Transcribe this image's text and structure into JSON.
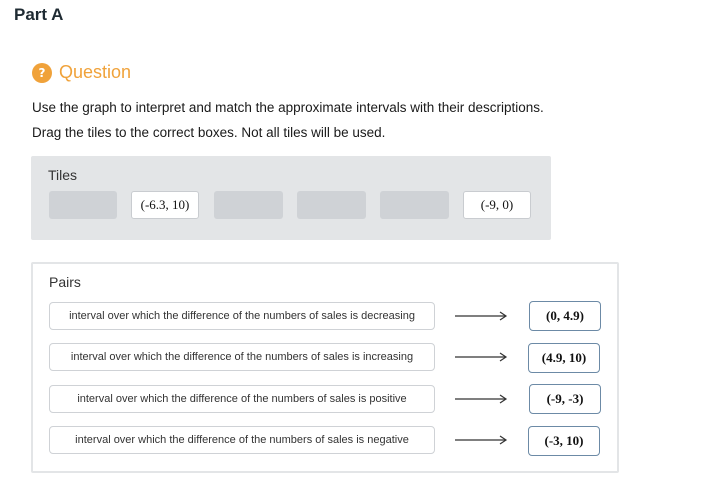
{
  "part_title": "Part A",
  "question": {
    "icon": "question-mark-icon",
    "icon_glyph": "?",
    "label": "Question",
    "accent_color": "#f0a23a"
  },
  "instructions": [
    "Use the graph to interpret and match the approximate intervals with their descriptions.",
    "Drag the tiles to the correct boxes. Not all tiles will be used."
  ],
  "tiles": {
    "heading": "Tiles",
    "items": [
      {
        "label": "",
        "empty": true
      },
      {
        "label": "(-6.3, 10)",
        "empty": false
      },
      {
        "label": "",
        "empty": true
      },
      {
        "label": "",
        "empty": true
      },
      {
        "label": "",
        "empty": true
      },
      {
        "label": "(-9, 0)",
        "empty": false
      }
    ]
  },
  "pairs": {
    "heading": "Pairs",
    "rows": [
      {
        "description": "interval over which the difference of the numbers of sales is decreasing",
        "answer": "(0, 4.9)"
      },
      {
        "description": "interval over which the difference of the numbers of sales is increasing",
        "answer": "(4.9, 10)"
      },
      {
        "description": "interval over which the difference of the numbers of sales is positive",
        "answer": "(-9, -3)"
      },
      {
        "description": "interval over which the difference of the numbers of sales is negative",
        "answer": "(-3, 10)"
      }
    ]
  }
}
